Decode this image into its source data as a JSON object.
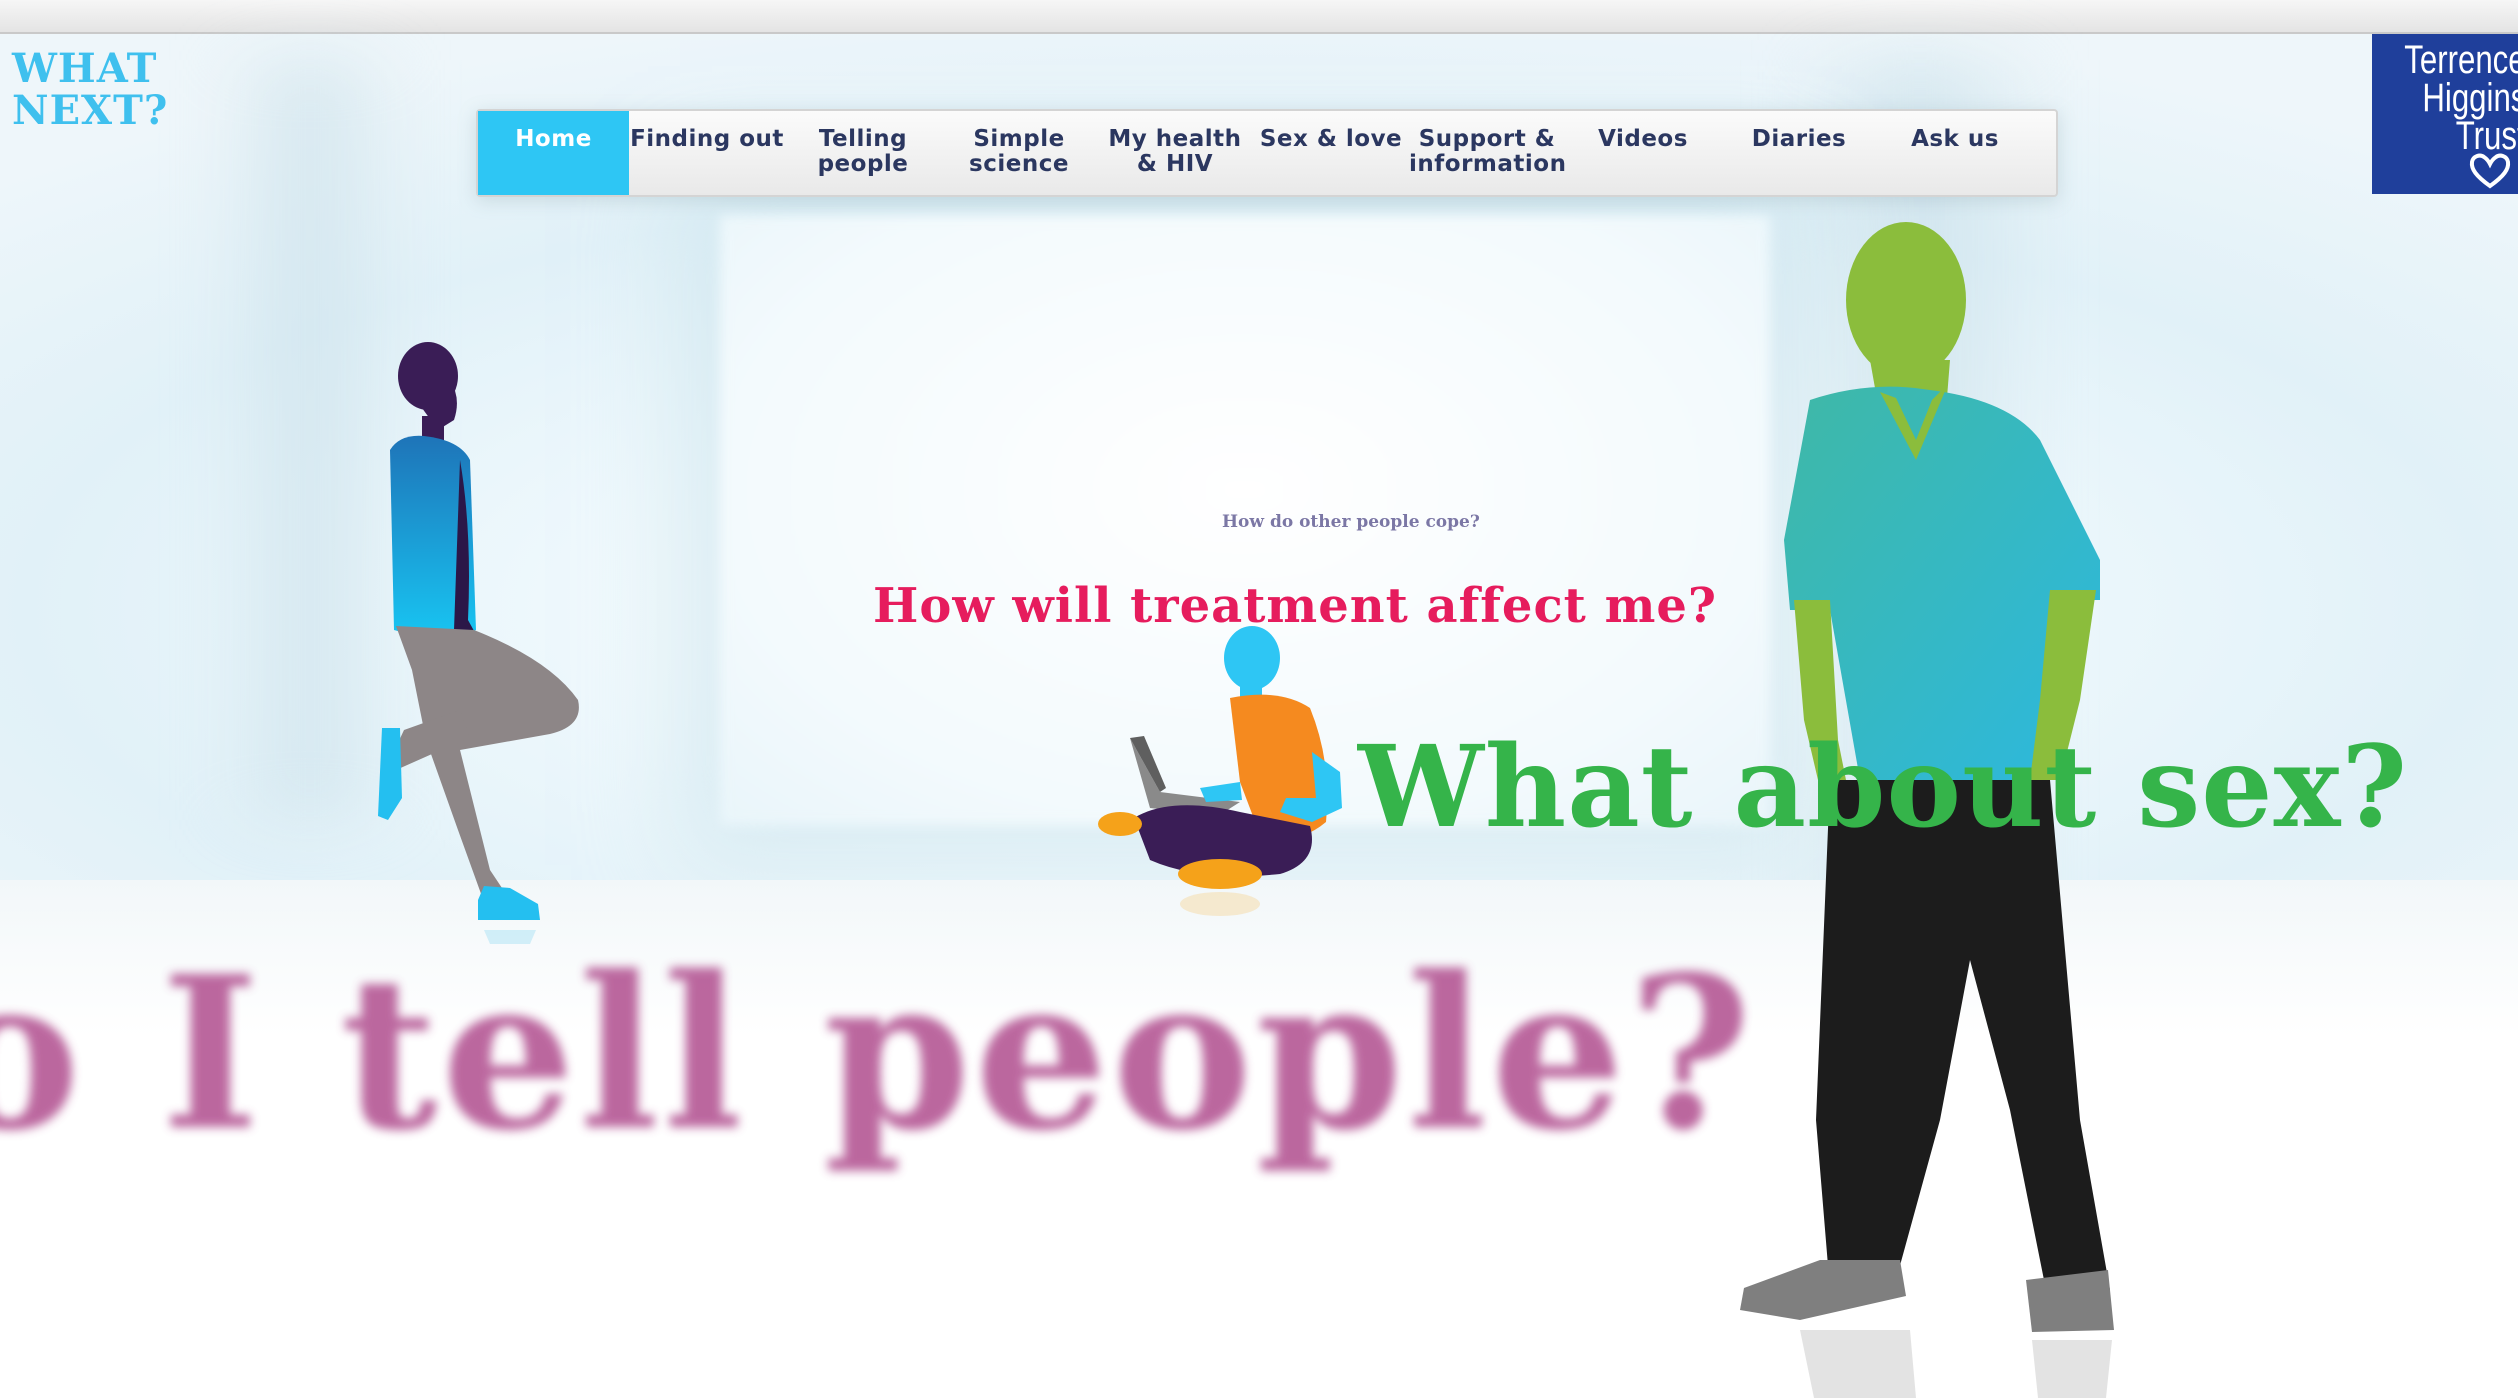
{
  "logo": {
    "line1": "WHAT",
    "line2": "NEXT?"
  },
  "partner_logo": {
    "line1": "Terrence",
    "line2": "Higgins",
    "line3": "Trust",
    "icon": "heart-icon"
  },
  "nav": {
    "items": [
      {
        "label": "Home",
        "active": true
      },
      {
        "label": "Finding out"
      },
      {
        "label": "Telling\npeople"
      },
      {
        "label": "Simple\nscience"
      },
      {
        "label": "My health\n& HIV"
      },
      {
        "label": "Sex & love"
      },
      {
        "label": "Support &\ninformation"
      },
      {
        "label": "Videos"
      },
      {
        "label": "Diaries"
      },
      {
        "label": "Ask us"
      }
    ]
  },
  "questions": {
    "cope": "How do other people cope?",
    "treatment": "How will treatment affect me?",
    "sex": "What about sex?",
    "tell": "o I tell people?"
  },
  "colors": {
    "nav_active": "#2ec6f4",
    "logo_blue": "#3fc0ee",
    "tht_blue": "#1f3f9b",
    "treatment_pink": "#e61c5d",
    "sex_green": "#35b44a",
    "tell_purple": "#b04d8e"
  }
}
